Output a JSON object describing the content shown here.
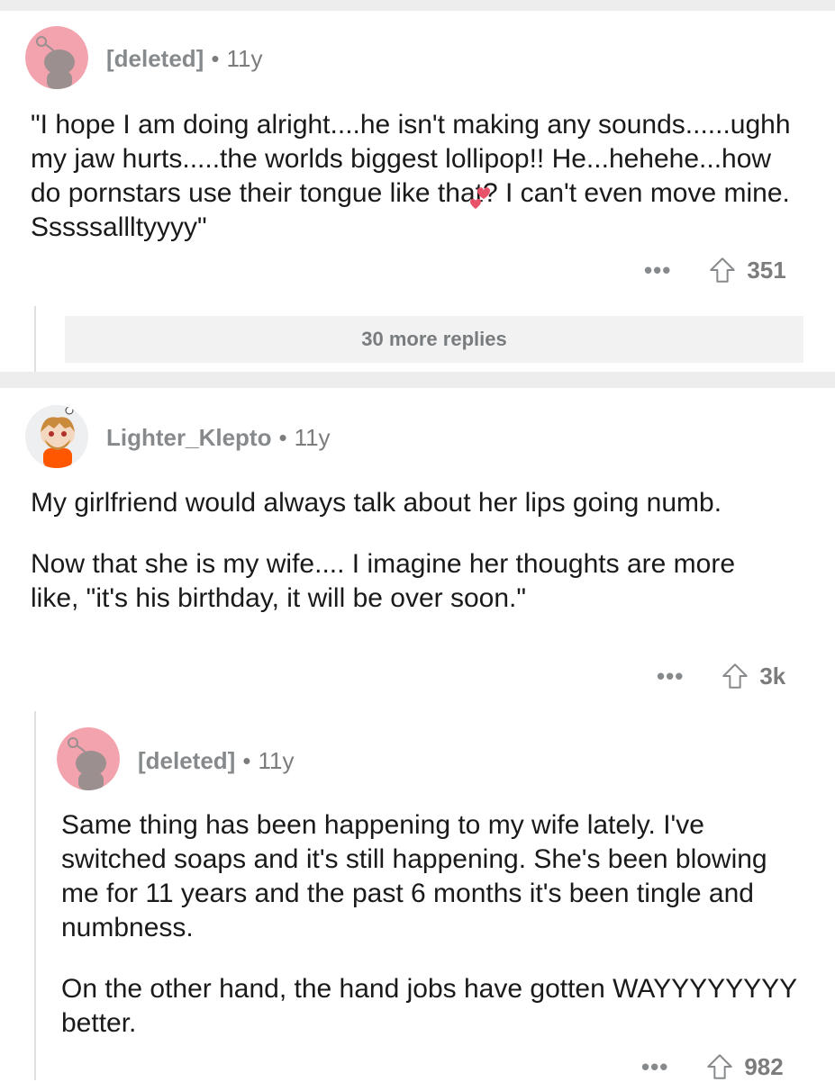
{
  "comments": [
    {
      "username": "[deleted]",
      "age": "11y",
      "paragraphs": [
        "\"I hope I am doing alright....he isn't making any sounds......ughh my jaw hurts.....the worlds biggest lollipop!! He...hehehe...how do pornstars use their tongue like that? I can't even move mine. Sssssallltyyyy\""
      ],
      "more_icon": "ellipsis-icon",
      "votes": "351",
      "more_replies_label": "30 more replies"
    },
    {
      "username": "Lighter_Klepto",
      "age": "11y",
      "paragraphs": [
        "My girlfriend  would always talk about her lips going numb.",
        "Now that she is my wife.... I imagine her thoughts are more like, \"it's his birthday, it will be over soon.\""
      ],
      "more_icon": "ellipsis-icon",
      "votes": "3k"
    },
    {
      "username": "[deleted]",
      "age": "11y",
      "paragraphs": [
        "Same thing has been happening to my wife lately. I've switched soaps and it's still happening. She's been blowing me for 11 years and the past 6 months it's been tingle and numbness.",
        "On the other hand, the hand jobs have gotten WAYYYYYYYY better."
      ],
      "more_icon": "ellipsis-icon",
      "votes": "982"
    }
  ],
  "separator_dot": "•",
  "ellipsis": "•••",
  "colors": {
    "deleted_avatar_bg": "#f2a3ad",
    "alien": "#9b8f8f",
    "heart": "#e8536a",
    "meta": "#7c7c7c"
  }
}
